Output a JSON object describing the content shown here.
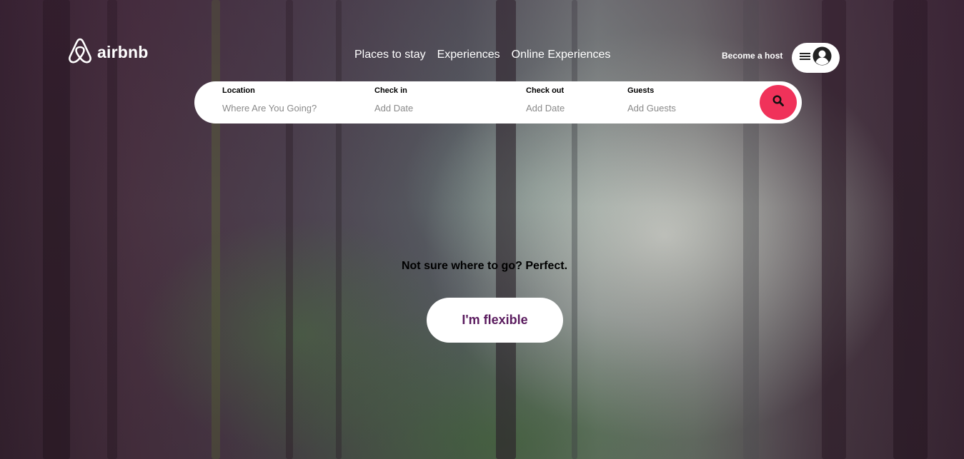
{
  "brand": {
    "logo_text": "airbnb",
    "logo_icon": "airbnb-belo-icon"
  },
  "nav": {
    "items": [
      {
        "label": "Places to stay"
      },
      {
        "label": "Experiences"
      },
      {
        "label": "Online Experiences"
      }
    ],
    "become_host": "Become a host",
    "menu_icon": "hamburger-icon",
    "avatar_icon": "user-avatar-icon"
  },
  "search": {
    "location": {
      "label": "Location",
      "placeholder": "Where Are You Going?"
    },
    "check_in": {
      "label": "Check in",
      "placeholder": "Add Date"
    },
    "check_out": {
      "label": "Check out",
      "placeholder": "Add Date"
    },
    "guests": {
      "label": "Guests",
      "placeholder": "Add Guests"
    },
    "button_icon": "search-icon"
  },
  "hero": {
    "tagline": "Not sure where to go? Perfect.",
    "cta_label": "I'm flexible"
  },
  "colors": {
    "accent": "#f0325a",
    "cta_text": "#5a1b5e",
    "white": "#ffffff"
  }
}
